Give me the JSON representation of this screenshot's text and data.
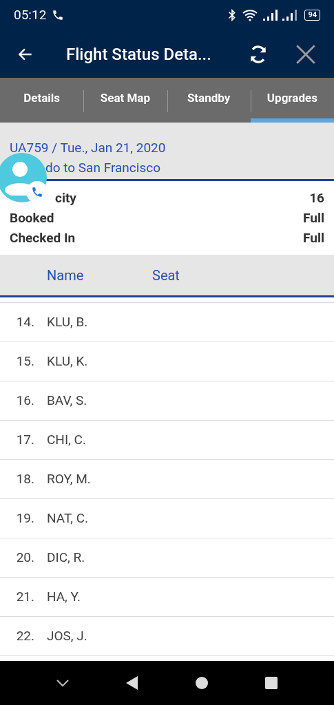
{
  "status_bar": {
    "time": "05:12",
    "battery": "94"
  },
  "app_bar": {
    "title": "Flight Status Deta..."
  },
  "tabs": [
    {
      "label": "Details",
      "selected": false
    },
    {
      "label": "Seat Map",
      "selected": false
    },
    {
      "label": "Standby",
      "selected": false
    },
    {
      "label": "Upgrades",
      "selected": true
    }
  ],
  "flight": {
    "line_1": "UA759 / Tue., Jan 21, 2020",
    "line_2": "do to San Francisco"
  },
  "summary": [
    {
      "label": "city",
      "value": "16"
    },
    {
      "label": "Booked",
      "value": "Full"
    },
    {
      "label": "Checked In",
      "value": "Full"
    }
  ],
  "table": {
    "columns": [
      "Name",
      "Seat"
    ],
    "rows": [
      {
        "number": "14.",
        "name": "KLU, B."
      },
      {
        "number": "15.",
        "name": "KLU, K."
      },
      {
        "number": "16.",
        "name": "BAV, S."
      },
      {
        "number": "17.",
        "name": "CHI, C."
      },
      {
        "number": "18.",
        "name": "ROY, M."
      },
      {
        "number": "19.",
        "name": "NAT, C."
      },
      {
        "number": "20.",
        "name": "DIC, R."
      },
      {
        "number": "21.",
        "name": "HA, Y."
      },
      {
        "number": "22.",
        "name": "JOS, J."
      }
    ]
  }
}
